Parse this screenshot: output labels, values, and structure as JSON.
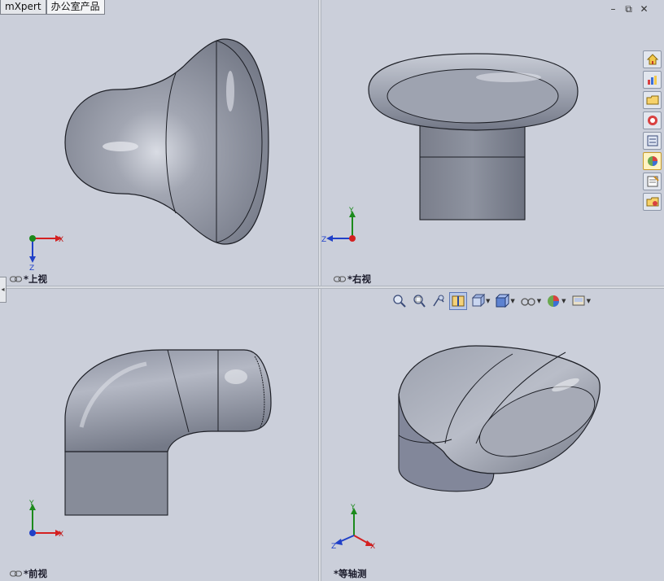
{
  "tabs": [
    {
      "label": "mXpert",
      "active": false
    },
    {
      "label": "办公室产品",
      "active": true
    }
  ],
  "viewports": {
    "top_left": {
      "label": "*上视",
      "triad": {
        "axis_h": "X",
        "axis_v": "Z"
      }
    },
    "top_right": {
      "label": "*右视",
      "triad": {
        "axis_h": "Z",
        "axis_v": "Y"
      }
    },
    "bottom_left": {
      "label": "*前视",
      "triad": {
        "axis_h": "X",
        "axis_v": "Y"
      }
    },
    "bottom_right": {
      "label": "*等轴测",
      "triad": {
        "axis_y": "Y",
        "axis_x": "X",
        "axis_z": "Z"
      }
    }
  },
  "window_controls": {
    "minimize": "–",
    "restore": "⧉",
    "close": "✕"
  },
  "task_pane_icons": [
    "home-icon",
    "resources-icon",
    "design-library-icon",
    "file-explorer-icon",
    "view-palette-icon",
    "appearances-icon",
    "custom-properties-icon",
    "recent-docs-icon"
  ],
  "view_toolbar_icons": [
    "zoom-to-fit-icon",
    "zoom-to-area-icon",
    "previous-view-icon",
    "section-view-icon",
    "view-orientation-icon",
    "display-style-icon",
    "hide-show-items-icon",
    "edit-appearance-icon",
    "apply-scene-icon"
  ],
  "colors": {
    "background": "#cbcfda",
    "model": "#8e93a0",
    "axis_x": "#d42020",
    "axis_y": "#1c8a1c",
    "axis_z": "#2040c8"
  }
}
